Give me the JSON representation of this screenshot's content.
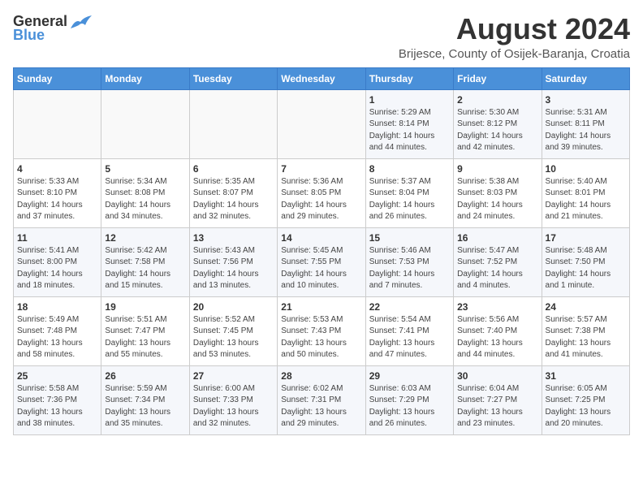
{
  "header": {
    "logo_general": "General",
    "logo_blue": "Blue",
    "main_title": "August 2024",
    "subtitle": "Brijesce, County of Osijek-Baranja, Croatia"
  },
  "weekdays": [
    "Sunday",
    "Monday",
    "Tuesday",
    "Wednesday",
    "Thursday",
    "Friday",
    "Saturday"
  ],
  "weeks": [
    [
      {
        "day": "",
        "info": ""
      },
      {
        "day": "",
        "info": ""
      },
      {
        "day": "",
        "info": ""
      },
      {
        "day": "",
        "info": ""
      },
      {
        "day": "1",
        "info": "Sunrise: 5:29 AM\nSunset: 8:14 PM\nDaylight: 14 hours\nand 44 minutes."
      },
      {
        "day": "2",
        "info": "Sunrise: 5:30 AM\nSunset: 8:12 PM\nDaylight: 14 hours\nand 42 minutes."
      },
      {
        "day": "3",
        "info": "Sunrise: 5:31 AM\nSunset: 8:11 PM\nDaylight: 14 hours\nand 39 minutes."
      }
    ],
    [
      {
        "day": "4",
        "info": "Sunrise: 5:33 AM\nSunset: 8:10 PM\nDaylight: 14 hours\nand 37 minutes."
      },
      {
        "day": "5",
        "info": "Sunrise: 5:34 AM\nSunset: 8:08 PM\nDaylight: 14 hours\nand 34 minutes."
      },
      {
        "day": "6",
        "info": "Sunrise: 5:35 AM\nSunset: 8:07 PM\nDaylight: 14 hours\nand 32 minutes."
      },
      {
        "day": "7",
        "info": "Sunrise: 5:36 AM\nSunset: 8:05 PM\nDaylight: 14 hours\nand 29 minutes."
      },
      {
        "day": "8",
        "info": "Sunrise: 5:37 AM\nSunset: 8:04 PM\nDaylight: 14 hours\nand 26 minutes."
      },
      {
        "day": "9",
        "info": "Sunrise: 5:38 AM\nSunset: 8:03 PM\nDaylight: 14 hours\nand 24 minutes."
      },
      {
        "day": "10",
        "info": "Sunrise: 5:40 AM\nSunset: 8:01 PM\nDaylight: 14 hours\nand 21 minutes."
      }
    ],
    [
      {
        "day": "11",
        "info": "Sunrise: 5:41 AM\nSunset: 8:00 PM\nDaylight: 14 hours\nand 18 minutes."
      },
      {
        "day": "12",
        "info": "Sunrise: 5:42 AM\nSunset: 7:58 PM\nDaylight: 14 hours\nand 15 minutes."
      },
      {
        "day": "13",
        "info": "Sunrise: 5:43 AM\nSunset: 7:56 PM\nDaylight: 14 hours\nand 13 minutes."
      },
      {
        "day": "14",
        "info": "Sunrise: 5:45 AM\nSunset: 7:55 PM\nDaylight: 14 hours\nand 10 minutes."
      },
      {
        "day": "15",
        "info": "Sunrise: 5:46 AM\nSunset: 7:53 PM\nDaylight: 14 hours\nand 7 minutes."
      },
      {
        "day": "16",
        "info": "Sunrise: 5:47 AM\nSunset: 7:52 PM\nDaylight: 14 hours\nand 4 minutes."
      },
      {
        "day": "17",
        "info": "Sunrise: 5:48 AM\nSunset: 7:50 PM\nDaylight: 14 hours\nand 1 minute."
      }
    ],
    [
      {
        "day": "18",
        "info": "Sunrise: 5:49 AM\nSunset: 7:48 PM\nDaylight: 13 hours\nand 58 minutes."
      },
      {
        "day": "19",
        "info": "Sunrise: 5:51 AM\nSunset: 7:47 PM\nDaylight: 13 hours\nand 55 minutes."
      },
      {
        "day": "20",
        "info": "Sunrise: 5:52 AM\nSunset: 7:45 PM\nDaylight: 13 hours\nand 53 minutes."
      },
      {
        "day": "21",
        "info": "Sunrise: 5:53 AM\nSunset: 7:43 PM\nDaylight: 13 hours\nand 50 minutes."
      },
      {
        "day": "22",
        "info": "Sunrise: 5:54 AM\nSunset: 7:41 PM\nDaylight: 13 hours\nand 47 minutes."
      },
      {
        "day": "23",
        "info": "Sunrise: 5:56 AM\nSunset: 7:40 PM\nDaylight: 13 hours\nand 44 minutes."
      },
      {
        "day": "24",
        "info": "Sunrise: 5:57 AM\nSunset: 7:38 PM\nDaylight: 13 hours\nand 41 minutes."
      }
    ],
    [
      {
        "day": "25",
        "info": "Sunrise: 5:58 AM\nSunset: 7:36 PM\nDaylight: 13 hours\nand 38 minutes."
      },
      {
        "day": "26",
        "info": "Sunrise: 5:59 AM\nSunset: 7:34 PM\nDaylight: 13 hours\nand 35 minutes."
      },
      {
        "day": "27",
        "info": "Sunrise: 6:00 AM\nSunset: 7:33 PM\nDaylight: 13 hours\nand 32 minutes."
      },
      {
        "day": "28",
        "info": "Sunrise: 6:02 AM\nSunset: 7:31 PM\nDaylight: 13 hours\nand 29 minutes."
      },
      {
        "day": "29",
        "info": "Sunrise: 6:03 AM\nSunset: 7:29 PM\nDaylight: 13 hours\nand 26 minutes."
      },
      {
        "day": "30",
        "info": "Sunrise: 6:04 AM\nSunset: 7:27 PM\nDaylight: 13 hours\nand 23 minutes."
      },
      {
        "day": "31",
        "info": "Sunrise: 6:05 AM\nSunset: 7:25 PM\nDaylight: 13 hours\nand 20 minutes."
      }
    ]
  ]
}
